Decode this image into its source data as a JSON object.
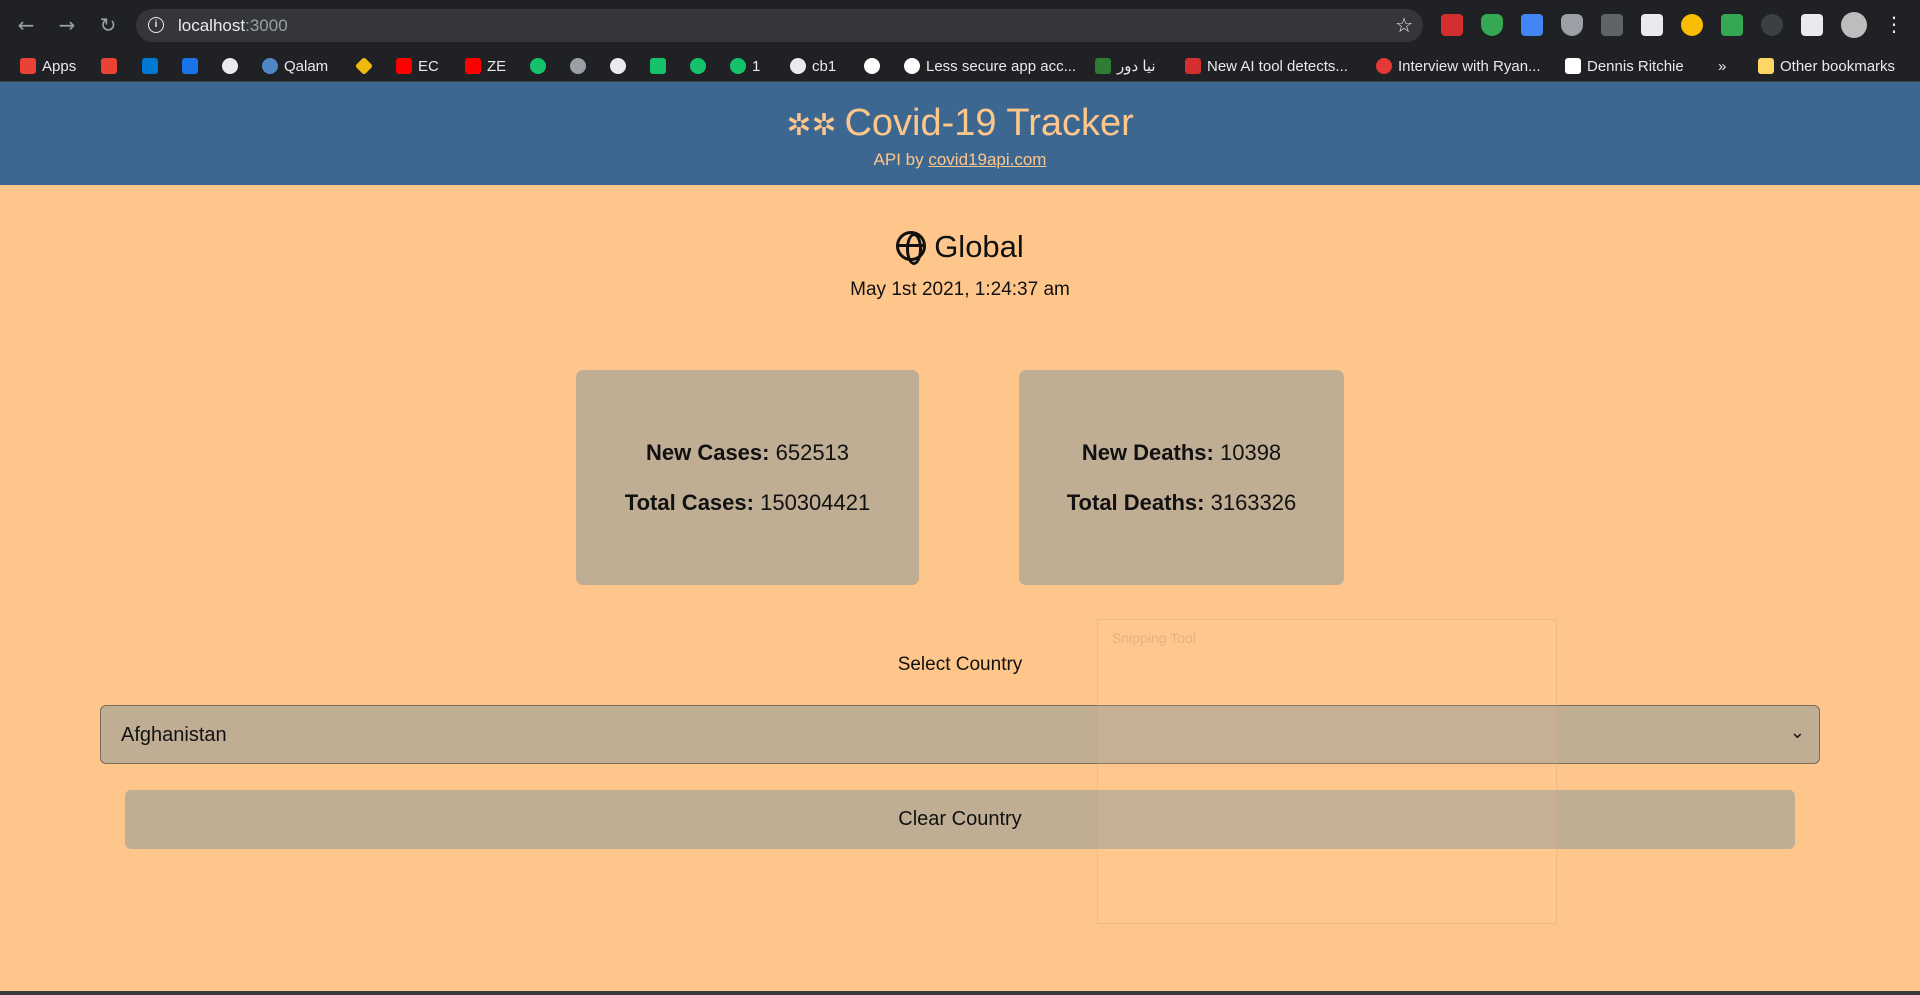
{
  "browser": {
    "url_host": "localhost",
    "url_port": ":3000",
    "bookmarks": [
      {
        "label": "Apps",
        "color": "#ea4335"
      },
      {
        "label": "",
        "color": "#ea4335"
      },
      {
        "label": "",
        "color": "#0078d4"
      },
      {
        "label": "",
        "color": "#1a73e8"
      },
      {
        "label": "",
        "color": "#e8eaed"
      },
      {
        "label": "Qalam",
        "color": "#4f86c6"
      },
      {
        "label": "",
        "color": "#f0b90b"
      },
      {
        "label": "EC",
        "color": "#ff0000"
      },
      {
        "label": "ZE",
        "color": "#ff0000"
      },
      {
        "label": "",
        "color": "#15c26b"
      },
      {
        "label": "",
        "color": "#9aa0a6"
      },
      {
        "label": "",
        "color": "#e8eaed"
      },
      {
        "label": "",
        "color": "#15c26b"
      },
      {
        "label": "",
        "color": "#15c26b"
      },
      {
        "label": "1",
        "color": "#15c26b"
      },
      {
        "label": "cb1",
        "color": "#e8eaed"
      },
      {
        "label": "",
        "color": "#ffffff"
      },
      {
        "label": "Less secure app acc...",
        "color": "#ffffff"
      },
      {
        "label": "نیا دور",
        "color": "#2e7d32"
      },
      {
        "label": "New AI tool detects...",
        "color": "#d32f2f"
      },
      {
        "label": "Interview with Ryan...",
        "color": "#e53935"
      },
      {
        "label": "Dennis Ritchie",
        "color": "#ffffff"
      },
      {
        "label": "»",
        "color": "transparent"
      },
      {
        "label": "Other bookmarks",
        "color": "#fdd663"
      }
    ]
  },
  "header": {
    "title": "Covid-19 Tracker",
    "api_prefix": "API by ",
    "api_link": "covid19api.com"
  },
  "global": {
    "heading": "Global",
    "timestamp": "May 1st 2021, 1:24:37 am"
  },
  "cases_card": {
    "new_label": "New Cases:",
    "new_value": "652513",
    "total_label": "Total Cases:",
    "total_value": "150304421"
  },
  "deaths_card": {
    "new_label": "New Deaths:",
    "new_value": "10398",
    "total_label": "Total Deaths:",
    "total_value": "3163326"
  },
  "country": {
    "label": "Select Country",
    "selected": "Afghanistan",
    "clear_label": "Clear Country"
  },
  "overlay": {
    "title": "Snipping Tool"
  }
}
